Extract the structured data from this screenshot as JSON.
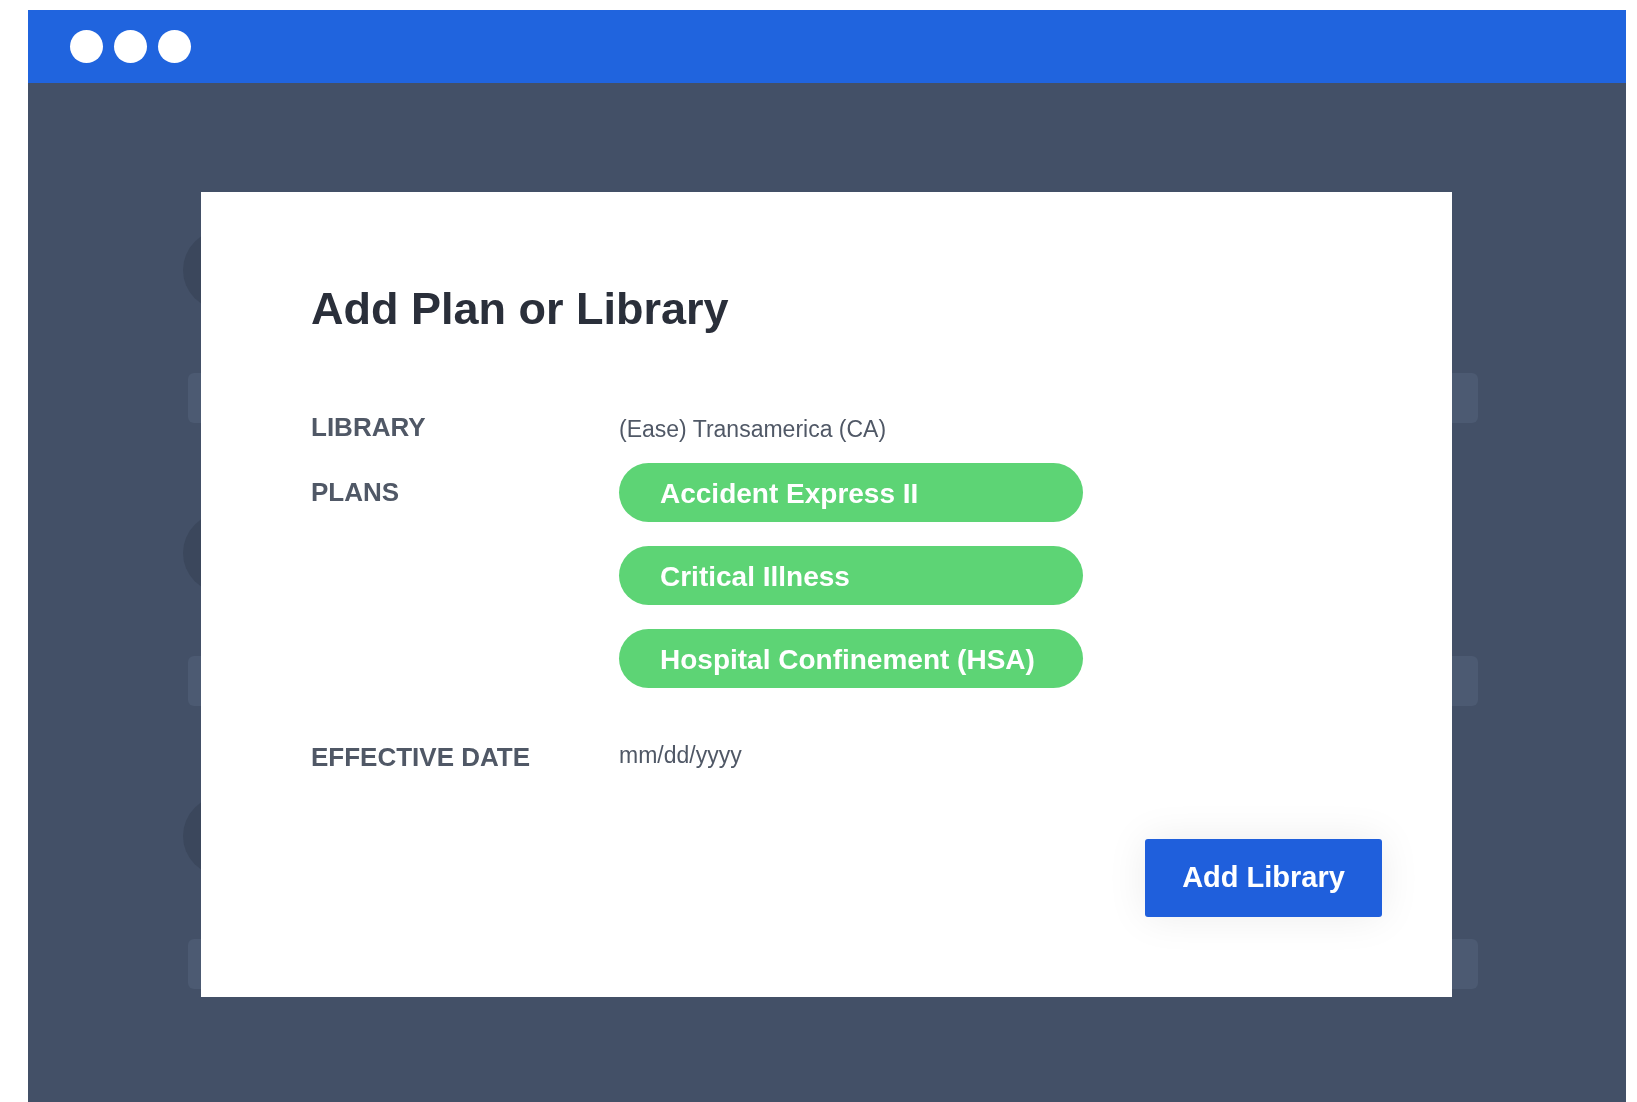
{
  "dialog": {
    "title": "Add Plan or Library",
    "fields": [
      {
        "label": "LIBRARY",
        "kind": "text",
        "value": "(Ease) Transamerica (CA)"
      },
      {
        "label": "PLANS",
        "kind": "tags",
        "tags": [
          "Accident Express II",
          "Critical Illness",
          "Hospital Confinement (HSA)"
        ]
      },
      {
        "label": "EFFECTIVE DATE",
        "kind": "date",
        "placeholder": "mm/dd/yyyy"
      }
    ],
    "button": "Add Library"
  }
}
